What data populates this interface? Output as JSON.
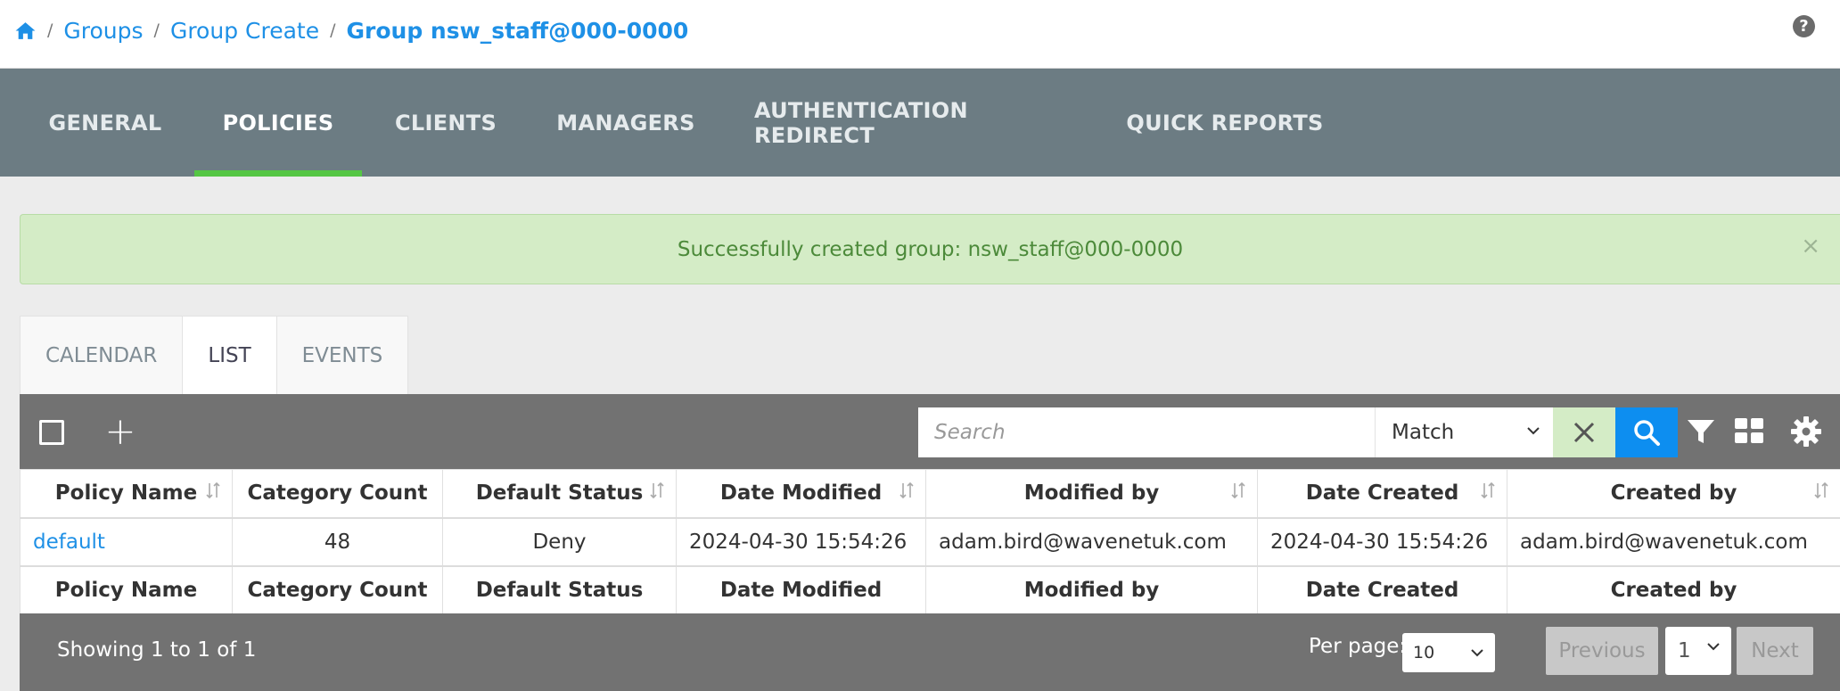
{
  "breadcrumb": {
    "home_icon": "home-icon",
    "items": [
      "Groups",
      "Group Create"
    ],
    "current": "Group nsw_staff@000-0000",
    "separator": "/"
  },
  "help_icon": {
    "icon": "question-circle-icon",
    "glyph": "?"
  },
  "main_tabs": [
    {
      "label": "GENERAL",
      "active": false
    },
    {
      "label": "POLICIES",
      "active": true
    },
    {
      "label": "CLIENTS",
      "active": false
    },
    {
      "label": "MANAGERS",
      "active": false
    },
    {
      "label": "AUTHENTICATION REDIRECT",
      "active": false
    },
    {
      "label": "QUICK REPORTS",
      "active": false
    }
  ],
  "alert": {
    "message": "Successfully created group: nsw_staff@000-0000",
    "close_glyph": "×"
  },
  "view_tabs": [
    {
      "label": "CALENDAR",
      "active": false
    },
    {
      "label": "LIST",
      "active": true
    },
    {
      "label": "EVENTS",
      "active": false
    }
  ],
  "toolbar": {
    "plus_glyph": "+",
    "search_placeholder": "Search",
    "search_value": "",
    "match_option": "Match",
    "icons": [
      "checkbox-icon",
      "plus-icon",
      "clear-icon",
      "search-icon",
      "filter-icon",
      "grid-icon",
      "gear-icon"
    ]
  },
  "table": {
    "columns": [
      "Policy Name",
      "Category Count",
      "Default Status",
      "Date Modified",
      "Modified by",
      "Date Created",
      "Created by"
    ],
    "rows": [
      {
        "policy_name": "default",
        "category_count": "48",
        "default_status": "Deny",
        "date_modified": "2024-04-30 15:54:26",
        "modified_by": "adam.bird@wavenetuk.com",
        "date_created": "2024-04-30 15:54:26",
        "created_by": "adam.bird@wavenetuk.com"
      }
    ]
  },
  "footer": {
    "showing": "Showing 1 to 1 of 1",
    "per_page_label": "Per page:",
    "per_page_value": "10",
    "previous_label": "Previous",
    "page_value": "1",
    "next_label": "Next"
  },
  "colors": {
    "link": "#1e90e6",
    "nav_bg": "#6c7c83",
    "active_tab_underline": "#55c644",
    "alert_bg": "#d4ecc6",
    "alert_text": "#4c8a3a",
    "toolbar_bg": "#727272",
    "search_button": "#0d8ef0"
  }
}
